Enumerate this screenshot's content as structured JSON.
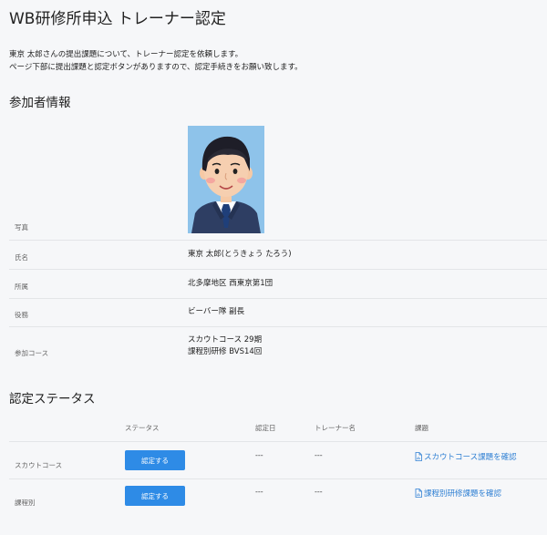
{
  "page": {
    "title": "WB研修所申込 トレーナー認定",
    "intro_line1": "東京 太郎さんの提出課題について、トレーナー認定を依頼します。",
    "intro_line2": "ページ下部に提出課題と認定ボタンがありますので、認定手続きをお願い致します。"
  },
  "participant": {
    "section_title": "参加者情報",
    "photo_label": "写真",
    "name_label": "氏名",
    "name_value": "東京 太郎(とうきょう たろう)",
    "affiliation_label": "所属",
    "affiliation_value": "北多摩地区 西東京第1団",
    "role_label": "役務",
    "role_value": "ビーバー隊 副長",
    "course_label": "参加コース",
    "course_line1": "スカウトコース 29期",
    "course_line2": "課程別研修 BVS14回"
  },
  "status": {
    "section_title": "認定ステータス",
    "columns": [
      "ステータス",
      "認定日",
      "トレーナー名",
      "課題"
    ],
    "rows": [
      {
        "label": "スカウトコース",
        "button": "認定する",
        "date": "---",
        "trainer": "---",
        "link": "スカウトコース課題を確認"
      },
      {
        "label": "課程別",
        "button": "認定する",
        "date": "---",
        "trainer": "---",
        "link": "課程別研修課題を確認"
      }
    ]
  }
}
